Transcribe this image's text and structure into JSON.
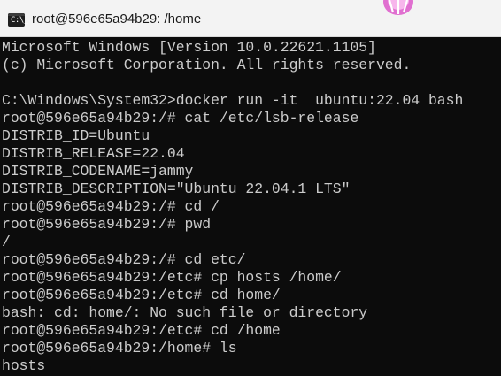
{
  "window": {
    "title": "root@596e65a94b29: /home",
    "icon": "terminal-icon",
    "icon_text": "C:\\_"
  },
  "colors": {
    "background": "#0c0c0c",
    "foreground": "#cccccc",
    "titlebar": "#f3f3f3"
  },
  "terminal": {
    "lines": [
      "Microsoft Windows [Version 10.0.22621.1105]",
      "(c) Microsoft Corporation. All rights reserved.",
      "",
      "C:\\Windows\\System32>docker run -it  ubuntu:22.04 bash",
      "root@596e65a94b29:/# cat /etc/lsb-release",
      "DISTRIB_ID=Ubuntu",
      "DISTRIB_RELEASE=22.04",
      "DISTRIB_CODENAME=jammy",
      "DISTRIB_DESCRIPTION=\"Ubuntu 22.04.1 LTS\"",
      "root@596e65a94b29:/# cd /",
      "root@596e65a94b29:/# pwd",
      "/",
      "root@596e65a94b29:/# cd etc/",
      "root@596e65a94b29:/etc# cp hosts /home/",
      "root@596e65a94b29:/etc# cd home/",
      "bash: cd: home/: No such file or directory",
      "root@596e65a94b29:/etc# cd /home",
      "root@596e65a94b29:/home# ls",
      "hosts"
    ]
  }
}
